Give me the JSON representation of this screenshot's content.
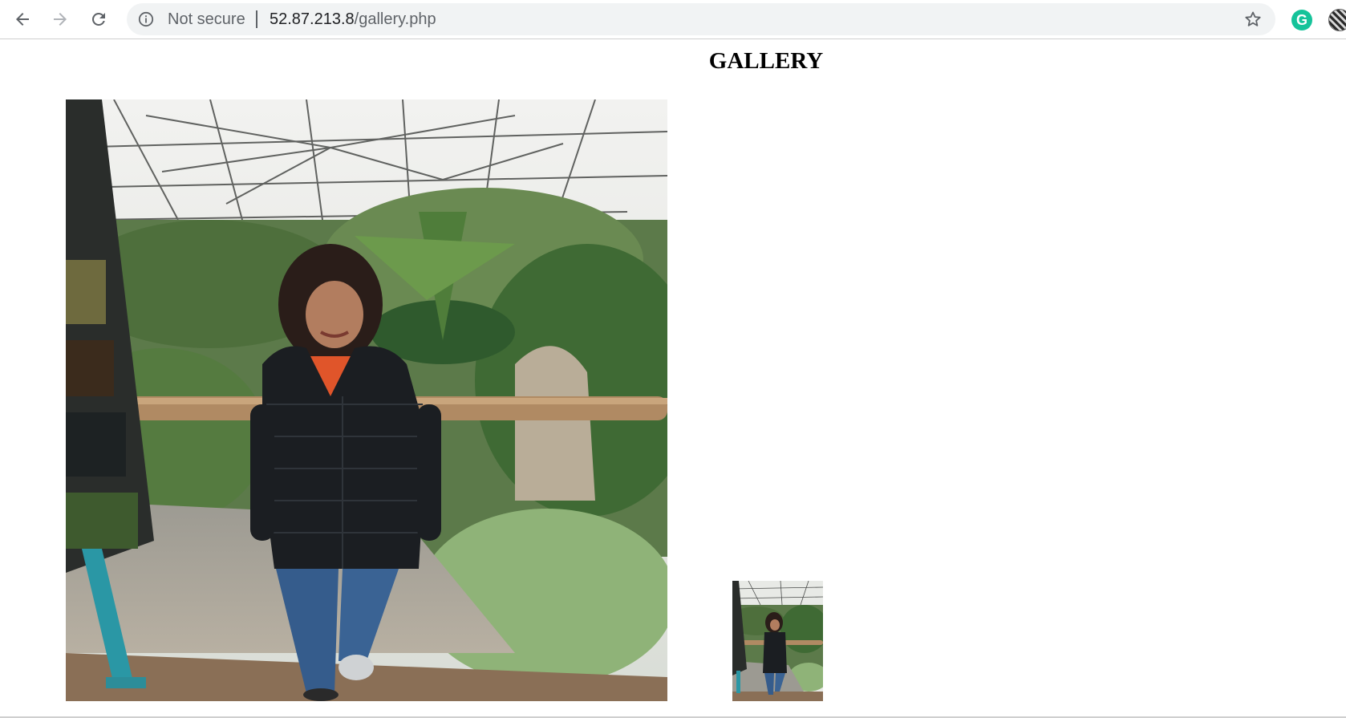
{
  "browser": {
    "nav": {
      "back_icon": "arrow-left-icon",
      "forward_icon": "arrow-right-icon",
      "reload_icon": "reload-icon"
    },
    "address_bar": {
      "security_label": "Not secure",
      "url_host": "52.87.213.8",
      "url_path": "/gallery.php"
    },
    "extensions": {
      "grammarly_letter": "G"
    }
  },
  "page": {
    "title": "GALLERY",
    "images": [
      {
        "name": "gallery-photo-large",
        "description_icon": "photo"
      },
      {
        "name": "gallery-photo-thumbnail",
        "description_icon": "photo"
      }
    ]
  },
  "colors": {
    "omnibox_bg": "#f1f3f4",
    "grammarly": "#15c39a",
    "icon_gray": "#5f6368"
  }
}
